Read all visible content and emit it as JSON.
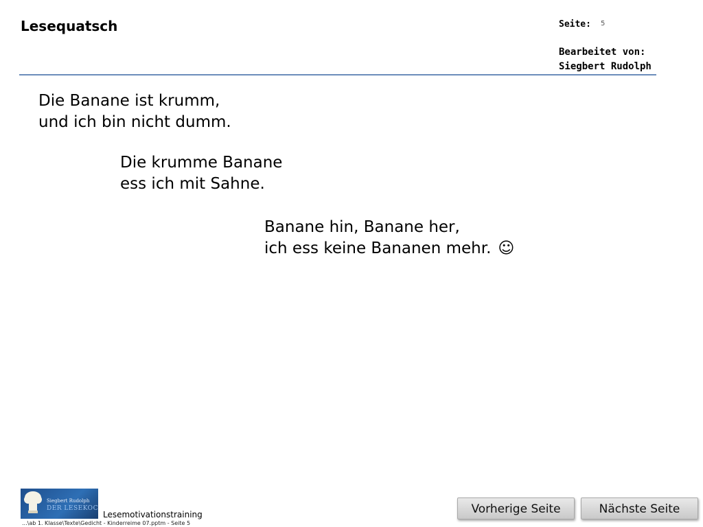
{
  "header": {
    "title": "Lesequatsch",
    "page_label": "Seite:",
    "page_number": "5",
    "editor_label": "Bearbeitet von:",
    "editor_name": "Siegbert Rudolph",
    "rule_color": "#6b8cba"
  },
  "poem": {
    "stanzas": [
      {
        "lines": [
          "Die Banane ist krumm,",
          "und ich bin nicht dumm."
        ]
      },
      {
        "lines": [
          "Die krumme Banane",
          "ess ich mit Sahne."
        ]
      },
      {
        "lines": [
          "Banane hin, Banane her,",
          "ich ess keine Bananen mehr."
        ]
      }
    ],
    "smiley": "☺"
  },
  "footer": {
    "logo": {
      "name": "Siegbert Rudolph",
      "brand": "DER LESEKOCH"
    },
    "label": "Lesemotivationstraining",
    "path": "...\\ab 1. Klasse\\Texte\\Gedicht - Kinderreime 07.pptm - Seite 5"
  },
  "navigation": {
    "prev_label": "Vorherige Seite",
    "next_label": "Nächste Seite"
  }
}
